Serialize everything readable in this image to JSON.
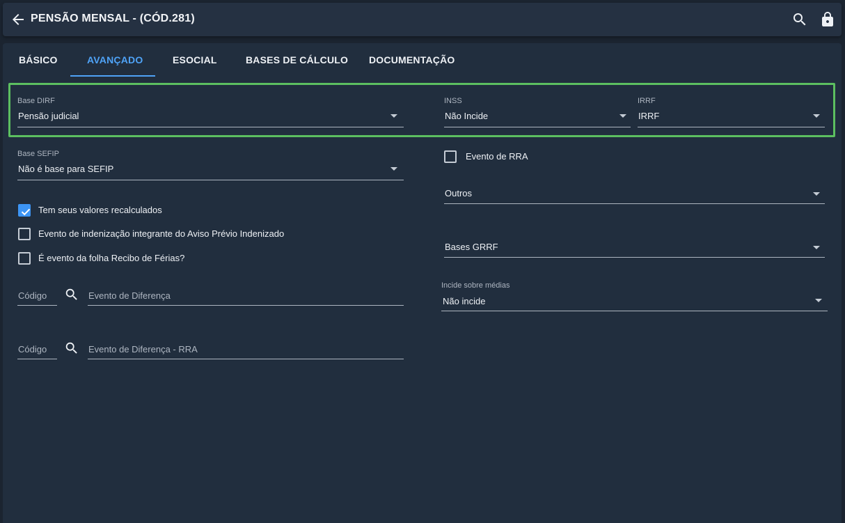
{
  "header": {
    "title": "PENSÃO MENSAL - (CÓD.281)",
    "back_icon": "arrow-left-icon",
    "search_icon": "search-icon",
    "lock_icon": "lock-icon"
  },
  "tabs": [
    {
      "label": "BÁSICO",
      "active": false
    },
    {
      "label": "AVANÇADO",
      "active": true
    },
    {
      "label": "ESOCIAL",
      "active": false
    },
    {
      "label": "BASES DE CÁLCULO",
      "active": false
    },
    {
      "label": "DOCUMENTAÇÃO",
      "active": false
    }
  ],
  "colors": {
    "accent": "#4fa3f7",
    "highlight": "#5cbf60",
    "background": "#212e3e"
  },
  "fields": {
    "base_dirf": {
      "label": "Base DIRF",
      "value": "Pensão judicial"
    },
    "inss": {
      "label": "INSS",
      "value": "Não Incide"
    },
    "irrf": {
      "label": "IRRF",
      "value": "IRRF"
    },
    "base_sefip": {
      "label": "Base SEFIP",
      "value": "Não é base para SEFIP"
    },
    "outros": {
      "value": "Outros"
    },
    "bases_grrf": {
      "value": "Bases GRRF"
    },
    "incide_medias": {
      "label": "Incide sobre médias",
      "value": "Não incide"
    }
  },
  "checkboxes": {
    "evento_rra": {
      "label": "Evento de RRA",
      "checked": false
    },
    "recalculados": {
      "label": "Tem seus valores recalculados",
      "checked": true
    },
    "indenizacao": {
      "label": "Evento de indenização integrante do Aviso Prévio Indenizado",
      "checked": false
    },
    "recibo_ferias": {
      "label": "É evento da folha Recibo de Férias?",
      "checked": false
    }
  },
  "lookups": {
    "diferenca": {
      "code_placeholder": "Código",
      "name_placeholder": "Evento de Diferença"
    },
    "diferenca_rra": {
      "code_placeholder": "Código",
      "name_placeholder": "Evento de Diferença - RRA"
    }
  }
}
